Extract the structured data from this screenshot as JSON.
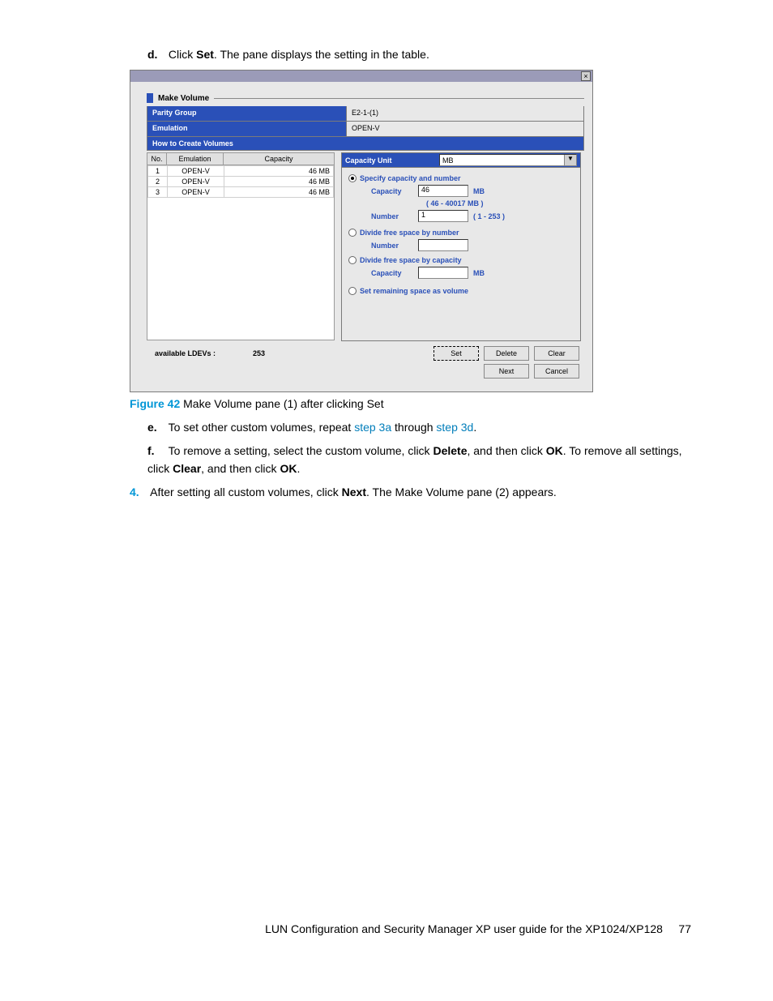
{
  "step_d": {
    "letter": "d.",
    "pre": "Click ",
    "bold": "Set",
    "post": ". The pane displays the setting in the table."
  },
  "shot": {
    "title": "Make Volume",
    "parity_label": "Parity Group",
    "parity_value": "E2-1-(1)",
    "emul_label": "Emulation",
    "emul_value": "OPEN-V",
    "how_label": "How to Create Volumes",
    "table": {
      "headers": {
        "no": "No.",
        "emulation": "Emulation",
        "capacity": "Capacity"
      },
      "rows": [
        {
          "no": "1",
          "emul": "OPEN-V",
          "cap": "46 MB"
        },
        {
          "no": "2",
          "emul": "OPEN-V",
          "cap": "46 MB"
        },
        {
          "no": "3",
          "emul": "OPEN-V",
          "cap": "46 MB"
        }
      ]
    },
    "cap_unit_label": "Capacity Unit",
    "cap_unit_value": "MB",
    "opt1": "Specify capacity and number",
    "cap_label": "Capacity",
    "cap_val": "46",
    "cap_suf": "MB",
    "cap_hint": "( 46 - 40017 MB )",
    "num_label": "Number",
    "num_val": "1",
    "num_suf": "( 1 - 253 )",
    "opt2": "Divide free space by number",
    "num2_label": "Number",
    "opt3": "Divide free space by capacity",
    "cap3_label": "Capacity",
    "cap3_suf": "MB",
    "opt4": "Set remaining space as volume",
    "avail_label": "available LDEVs :",
    "avail_val": "253",
    "btn_set": "Set",
    "btn_delete": "Delete",
    "btn_clear": "Clear",
    "btn_next": "Next",
    "btn_cancel": "Cancel",
    "close_glyph": "×"
  },
  "figure": {
    "label": "Figure 42",
    "text": "Make Volume pane (1) after clicking Set"
  },
  "step_e": {
    "letter": "e.",
    "pre": "To set other custom volumes, repeat ",
    "l1": "step 3a",
    "mid": " through ",
    "l2": "step 3d",
    "post": "."
  },
  "step_f": {
    "letter": "f.",
    "t1": "To remove a setting, select the custom volume, click ",
    "b1": "Delete",
    "t2": ", and then click ",
    "b2": "OK",
    "t3": ". To remove all settings, click ",
    "b3": "Clear",
    "t4": ", and then click ",
    "b4": "OK",
    "t5": "."
  },
  "step4": {
    "num": "4.",
    "t1": "After setting all custom volumes, click ",
    "b1": "Next",
    "t2": ". The Make Volume pane (2) appears."
  },
  "footer": {
    "text": "LUN Configuration and Security Manager XP user guide for the XP1024/XP128",
    "page": "77"
  }
}
